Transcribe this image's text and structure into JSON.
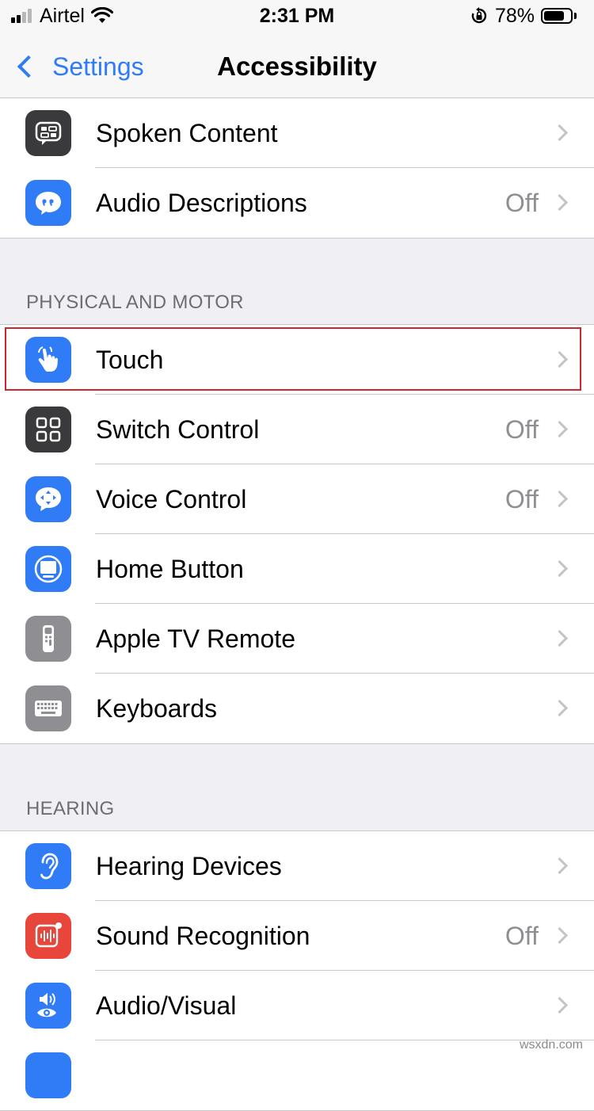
{
  "status_bar": {
    "carrier": "Airtel",
    "time": "2:31 PM",
    "battery_percent": "78%",
    "battery_level": 0.78,
    "signal_bars": 2,
    "icons": [
      "signal-icon",
      "wifi-icon",
      "orientation-lock-icon",
      "battery-icon"
    ]
  },
  "nav": {
    "back_label": "Settings",
    "title": "Accessibility"
  },
  "groups": {
    "top": {
      "rows": [
        {
          "label": "Spoken Content",
          "value": "",
          "icon": "spoken-content-icon",
          "color": "#3a3a3c"
        },
        {
          "label": "Audio Descriptions",
          "value": "Off",
          "icon": "audio-descriptions-icon",
          "color": "#2f7cf6"
        }
      ]
    },
    "physical": {
      "header": "PHYSICAL AND MOTOR",
      "rows": [
        {
          "label": "Touch",
          "value": "",
          "icon": "touch-icon",
          "color": "#2f7cf6"
        },
        {
          "label": "Switch Control",
          "value": "Off",
          "icon": "switch-control-icon",
          "color": "#3a3a3c"
        },
        {
          "label": "Voice Control",
          "value": "Off",
          "icon": "voice-control-icon",
          "color": "#2f7cf6"
        },
        {
          "label": "Home Button",
          "value": "",
          "icon": "home-button-icon",
          "color": "#2f7cf6"
        },
        {
          "label": "Apple TV Remote",
          "value": "",
          "icon": "apple-tv-remote-icon",
          "color": "#8e8e93"
        },
        {
          "label": "Keyboards",
          "value": "",
          "icon": "keyboard-icon",
          "color": "#8e8e93"
        }
      ]
    },
    "hearing": {
      "header": "HEARING",
      "rows": [
        {
          "label": "Hearing Devices",
          "value": "",
          "icon": "ear-icon",
          "color": "#2f7cf6"
        },
        {
          "label": "Sound Recognition",
          "value": "Off",
          "icon": "sound-recognition-icon",
          "color": "#e8463b"
        },
        {
          "label": "Audio/Visual",
          "value": "",
          "icon": "audio-visual-icon",
          "color": "#2f7cf6"
        }
      ]
    }
  },
  "colors": {
    "accent": "#2f7cf6",
    "highlight_box": "#d0262e"
  },
  "watermark": "wsxdn.com"
}
